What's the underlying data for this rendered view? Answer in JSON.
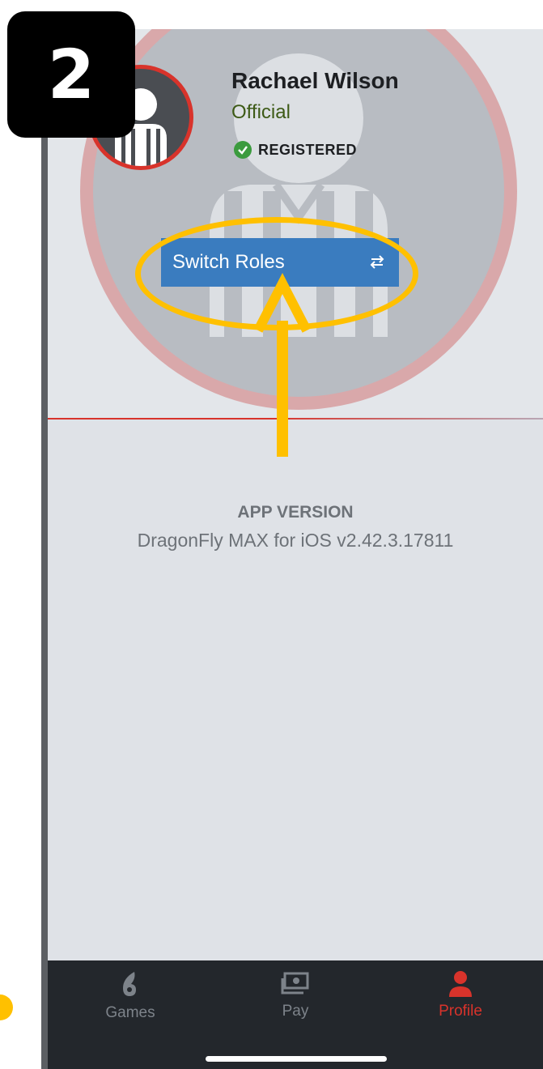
{
  "step_badge": "2",
  "profile": {
    "name": "Rachael Wilson",
    "role": "Official",
    "status": "REGISTERED"
  },
  "switch_roles": {
    "label": "Switch Roles",
    "icon": "swap-arrows-icon"
  },
  "app_version": {
    "label": "APP VERSION",
    "value": "DragonFly MAX for iOS v2.42.3.17811"
  },
  "tabbar": {
    "tabs": [
      {
        "label": "Games",
        "icon": "dragonfly-icon",
        "active": false
      },
      {
        "label": "Pay",
        "icon": "money-icon",
        "active": false
      },
      {
        "label": "Profile",
        "icon": "person-icon",
        "active": true
      }
    ]
  },
  "colors": {
    "accent_red": "#d8332b",
    "button_blue": "#3a7cbf",
    "annotation_yellow": "#ffc000",
    "role_green": "#3d5a16",
    "tabbar_bg": "#23272c",
    "inactive_tab": "#7d838a"
  }
}
